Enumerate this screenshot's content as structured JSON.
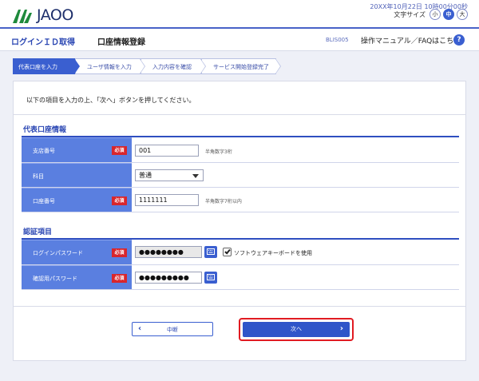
{
  "header": {
    "logo_text": "JAOO",
    "datetime": "20XX年10月22日 10時00分00秒",
    "font_size_label": "文字サイズ",
    "font_sizes": [
      "小",
      "中",
      "大"
    ],
    "font_size_selected": "中"
  },
  "titlebar": {
    "login_id": "ログインＩＤ取得",
    "page_title": "口座情報登録",
    "page_code": "BLIS005",
    "manual": "操作マニュアル／FAQはこちら",
    "help": "?"
  },
  "steps": [
    "代表口座を入力",
    "ユーザ情報を入力",
    "入力内容を確認",
    "サービス開始登録完了"
  ],
  "instruction": "以下の項目を入力の上、「次へ」ボタンを押してください。",
  "account_section": {
    "title": "代表口座情報",
    "branch_label": "支店番号",
    "branch_value": "001",
    "branch_hint": "半角数字3桁",
    "subject_label": "科目",
    "subject_value": "普通",
    "account_label": "口座番号",
    "account_value": "1111111",
    "account_hint": "半角数字7桁以内"
  },
  "auth_section": {
    "title": "認証項目",
    "password_label": "ログインパスワード",
    "password_value": "●●●●●●●●",
    "software_kb_label": "ソフトウェアキーボードを使用",
    "confirm_label": "確認用パスワード",
    "confirm_value": "●●●●●●●●●"
  },
  "required_label": "必須",
  "buttons": {
    "cancel": "中断",
    "cancel_icon": "‹",
    "next": "次へ",
    "next_icon": "›"
  }
}
